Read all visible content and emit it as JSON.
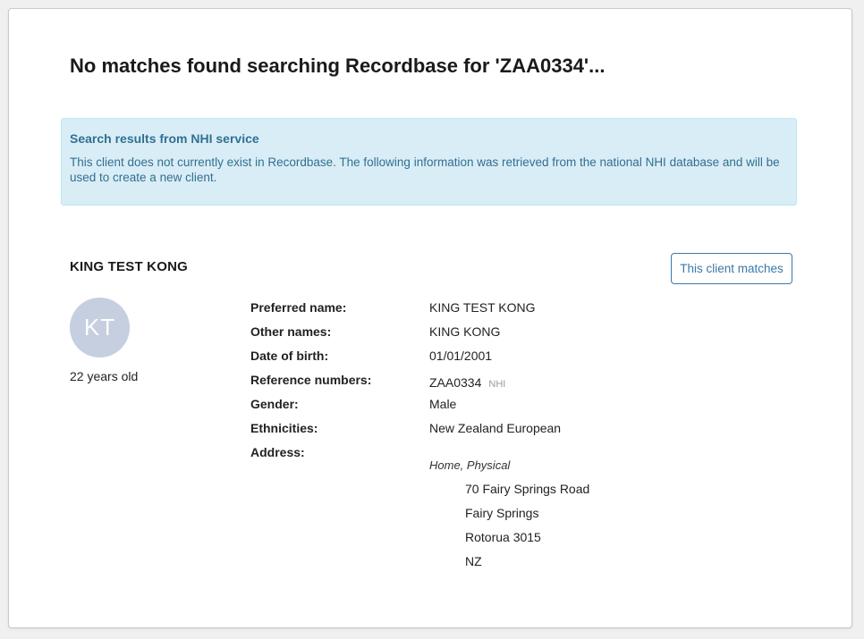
{
  "header": {
    "title": "No matches found searching Recordbase for 'ZAA0334'..."
  },
  "alert": {
    "title": "Search results from NHI service",
    "body": "This client does not currently exist in Recordbase. The following information was retrieved from the national NHI database and will be used to create a new client."
  },
  "client": {
    "name": "KING TEST KONG",
    "match_button": "This client matches",
    "avatar_initials": "KT",
    "age": "22 years old"
  },
  "details": {
    "preferred_name_label": "Preferred name:",
    "preferred_name": "KING TEST KONG",
    "other_names_label": "Other names:",
    "other_names": "KING KONG",
    "dob_label": "Date of birth:",
    "dob": "01/01/2001",
    "reference_label": "Reference numbers:",
    "reference_number": "ZAA0334",
    "reference_type": "NHI",
    "gender_label": "Gender:",
    "gender": "Male",
    "ethnicities_label": "Ethnicities:",
    "ethnicities": "New Zealand European",
    "address_label": "Address:",
    "address": {
      "type": "Home, Physical",
      "line1": "70 Fairy Springs Road",
      "line2": "Fairy Springs",
      "line3": "Rotorua 3015",
      "line4": "NZ"
    }
  },
  "colors": {
    "alert_bg": "#d9edf7",
    "alert_text": "#31708f",
    "button_accent": "#3a78a8",
    "avatar_bg": "#c5cfe0"
  }
}
